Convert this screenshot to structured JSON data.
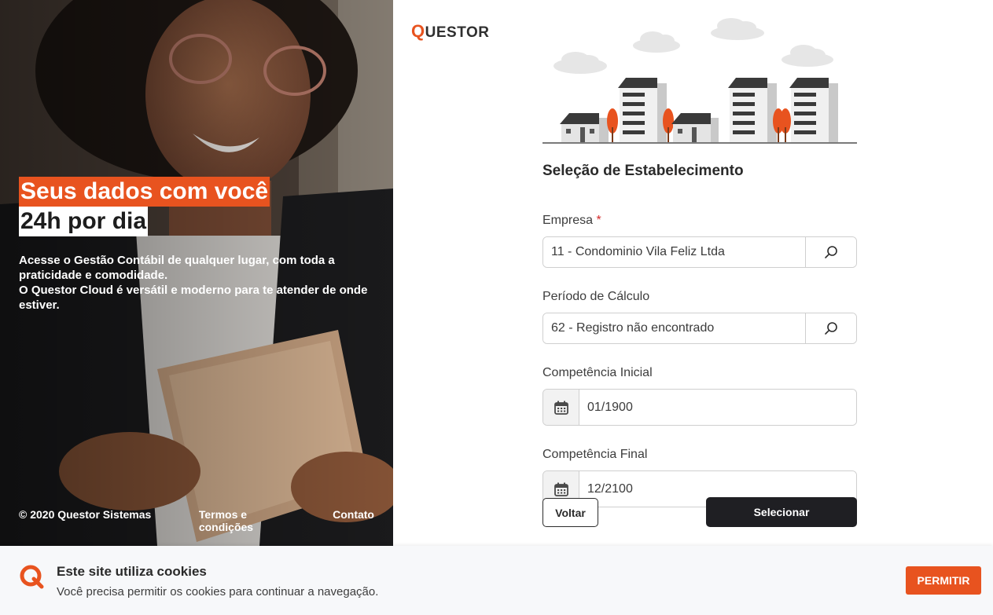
{
  "hero": {
    "headline_line1": "Seus dados com você",
    "headline_line2": "24h por dia",
    "description_line1": "Acesse o Gestão Contábil de qualquer lugar, com toda a praticidade e comodidade.",
    "description_line2": "O Questor Cloud é versátil e moderno para te atender de onde estiver.",
    "copyright": "© 2020 Questor Sistemas",
    "terms_link": "Termos e condições",
    "contact_link": "Contato"
  },
  "logo": {
    "first_letter": "Q",
    "rest": "UESTOR"
  },
  "form": {
    "title": "Seleção de Estabelecimento",
    "empresa": {
      "label": "Empresa",
      "required_marker": "*",
      "value": "11 - Condominio Vila Feliz Ltda",
      "icon": "search-icon"
    },
    "periodo": {
      "label": "Período de Cálculo",
      "value": "62 - Registro não encontrado",
      "icon": "search-icon"
    },
    "competencia_inicial": {
      "label": "Competência Inicial",
      "value": "01/1900",
      "icon": "calendar-icon"
    },
    "competencia_final": {
      "label": "Competência Final",
      "value": "12/2100",
      "icon": "calendar-icon"
    },
    "back_label": "Voltar",
    "select_label": "Selecionar"
  },
  "cookie": {
    "title": "Este site utiliza cookies",
    "text": "Você precisa permitir os cookies para continuar a navegação.",
    "button_label": "PERMITIR"
  },
  "colors": {
    "accent": "#e8531f",
    "dark_button": "#1f1f23"
  }
}
